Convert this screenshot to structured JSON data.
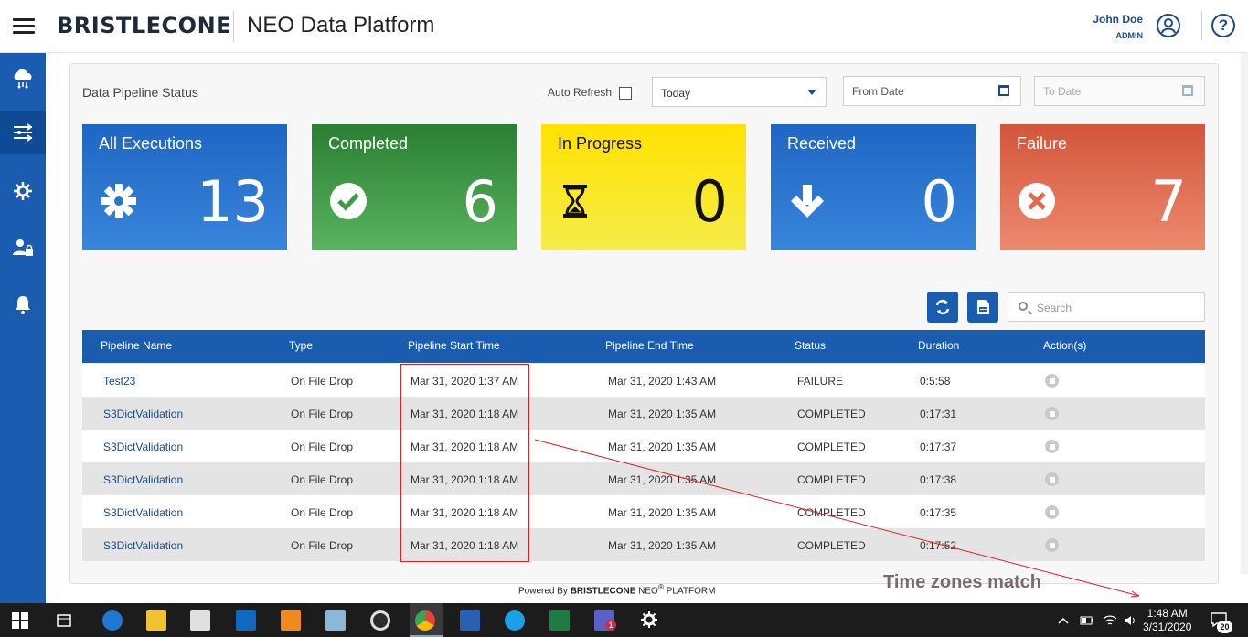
{
  "header": {
    "brand": "BRISTLECONE",
    "app_title": "NEO Data Platform",
    "user_name": "John Doe",
    "user_role": "ADMIN",
    "help_label": "?"
  },
  "sidebar": {
    "items": [
      {
        "icon": "cloud-data-icon",
        "active": false
      },
      {
        "icon": "pipeline-icon",
        "active": true
      },
      {
        "icon": "settings-sync-icon",
        "active": false
      },
      {
        "icon": "user-lock-icon",
        "active": false
      },
      {
        "icon": "bell-icon",
        "active": false
      }
    ]
  },
  "panel": {
    "title": "Data Pipeline Status",
    "auto_refresh_label": "Auto Refresh",
    "auto_refresh_checked": false,
    "range_select_value": "Today",
    "from_date_placeholder": "From Date",
    "to_date_placeholder": "To Date"
  },
  "cards": [
    {
      "title": "All Executions",
      "count": "13",
      "icon": "gear-icon",
      "color": "#2a74d0"
    },
    {
      "title": "Completed",
      "count": "6",
      "icon": "check-circle-icon",
      "color": "#3f9a45"
    },
    {
      "title": "In Progress",
      "count": "0",
      "icon": "hourglass-icon",
      "color": "#ffe600"
    },
    {
      "title": "Received",
      "count": "0",
      "icon": "arrow-down-icon",
      "color": "#2a74d0"
    },
    {
      "title": "Failure",
      "count": "7",
      "icon": "x-circle-icon",
      "color": "#e06a4f"
    }
  ],
  "toolbar": {
    "search_placeholder": "Search"
  },
  "table": {
    "headers": [
      "Pipeline Name",
      "Type",
      "Pipeline Start Time",
      "Pipeline End Time",
      "Status",
      "Duration",
      "Action(s)"
    ],
    "rows": [
      [
        "Test23",
        "On File Drop",
        "Mar 31, 2020 1:37 AM",
        "Mar 31, 2020 1:43 AM",
        "FAILURE",
        "0:5:58"
      ],
      [
        "S3DictValidation",
        "On File Drop",
        "Mar 31, 2020 1:18 AM",
        "Mar 31, 2020 1:35 AM",
        "COMPLETED",
        "0:17:31"
      ],
      [
        "S3DictValidation",
        "On File Drop",
        "Mar 31, 2020 1:18 AM",
        "Mar 31, 2020 1:35 AM",
        "COMPLETED",
        "0:17:37"
      ],
      [
        "S3DictValidation",
        "On File Drop",
        "Mar 31, 2020 1:18 AM",
        "Mar 31, 2020 1:35 AM",
        "COMPLETED",
        "0:17:38"
      ],
      [
        "S3DictValidation",
        "On File Drop",
        "Mar 31, 2020 1:18 AM",
        "Mar 31, 2020 1:35 AM",
        "COMPLETED",
        "0:17:35"
      ],
      [
        "S3DictValidation",
        "On File Drop",
        "Mar 31, 2020 1:18 AM",
        "Mar 31, 2020 1:35 AM",
        "COMPLETED",
        "0:17:52"
      ]
    ]
  },
  "footer": {
    "powered_prefix": "Powered By",
    "powered_brand": "BRISTLECONE",
    "powered_product": "NEO",
    "registered_mark": "®",
    "powered_suffix": "PLATFORM"
  },
  "annotation": {
    "text": "Time zones match"
  },
  "taskbar": {
    "time": "1:48 AM",
    "date": "3/31/2020",
    "notification_count": "20",
    "teams_badge": "1"
  }
}
